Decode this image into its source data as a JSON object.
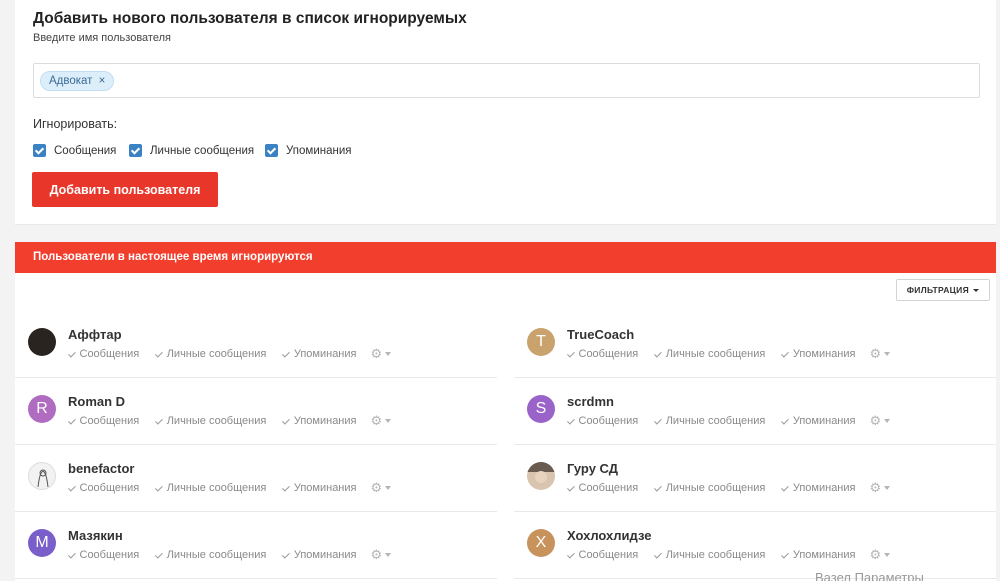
{
  "add_section": {
    "title": "Добавить нового пользователя в список игнорируемых",
    "hint": "Введите имя пользователя",
    "tag": "Адвокат",
    "tag_remove": "×",
    "ignore_label": "Игнорировать:",
    "checkboxes": [
      {
        "label": "Сообщения",
        "checked": true
      },
      {
        "label": "Личные сообщения",
        "checked": true
      },
      {
        "label": "Упоминания",
        "checked": true
      }
    ],
    "submit_label": "Добавить пользователя"
  },
  "users_section": {
    "header": "Пользователи в настоящее время игнорируются",
    "filter_label": "ФИЛЬТРАЦИЯ",
    "perm_labels": [
      "Сообщения",
      "Личные сообщения",
      "Упоминания"
    ],
    "users": [
      {
        "name": "Аффтар",
        "avatar_letter": "",
        "avatar_color": "#2a2420"
      },
      {
        "name": "TrueCoach",
        "avatar_letter": "T",
        "avatar_color": "#c9a26e"
      },
      {
        "name": "Roman D",
        "avatar_letter": "R",
        "avatar_color": "#b06cc0"
      },
      {
        "name": "scrdmn",
        "avatar_letter": "S",
        "avatar_color": "#9a63c9"
      },
      {
        "name": "benefactor",
        "avatar_letter": "",
        "avatar_color": "#f2f2f2"
      },
      {
        "name": "Гуру СД",
        "avatar_letter": "",
        "avatar_color": "#d9c4b0"
      },
      {
        "name": "Мазякин",
        "avatar_letter": "M",
        "avatar_color": "#7a5ec9"
      },
      {
        "name": "Хохлохлидзе",
        "avatar_letter": "X",
        "avatar_color": "#c8925c"
      }
    ]
  },
  "footer_ghost": "Вазел Параметры",
  "colors": {
    "accent_red": "#e8372a",
    "header_red": "#f13e2d",
    "checkbox_blue": "#3b82c4"
  }
}
